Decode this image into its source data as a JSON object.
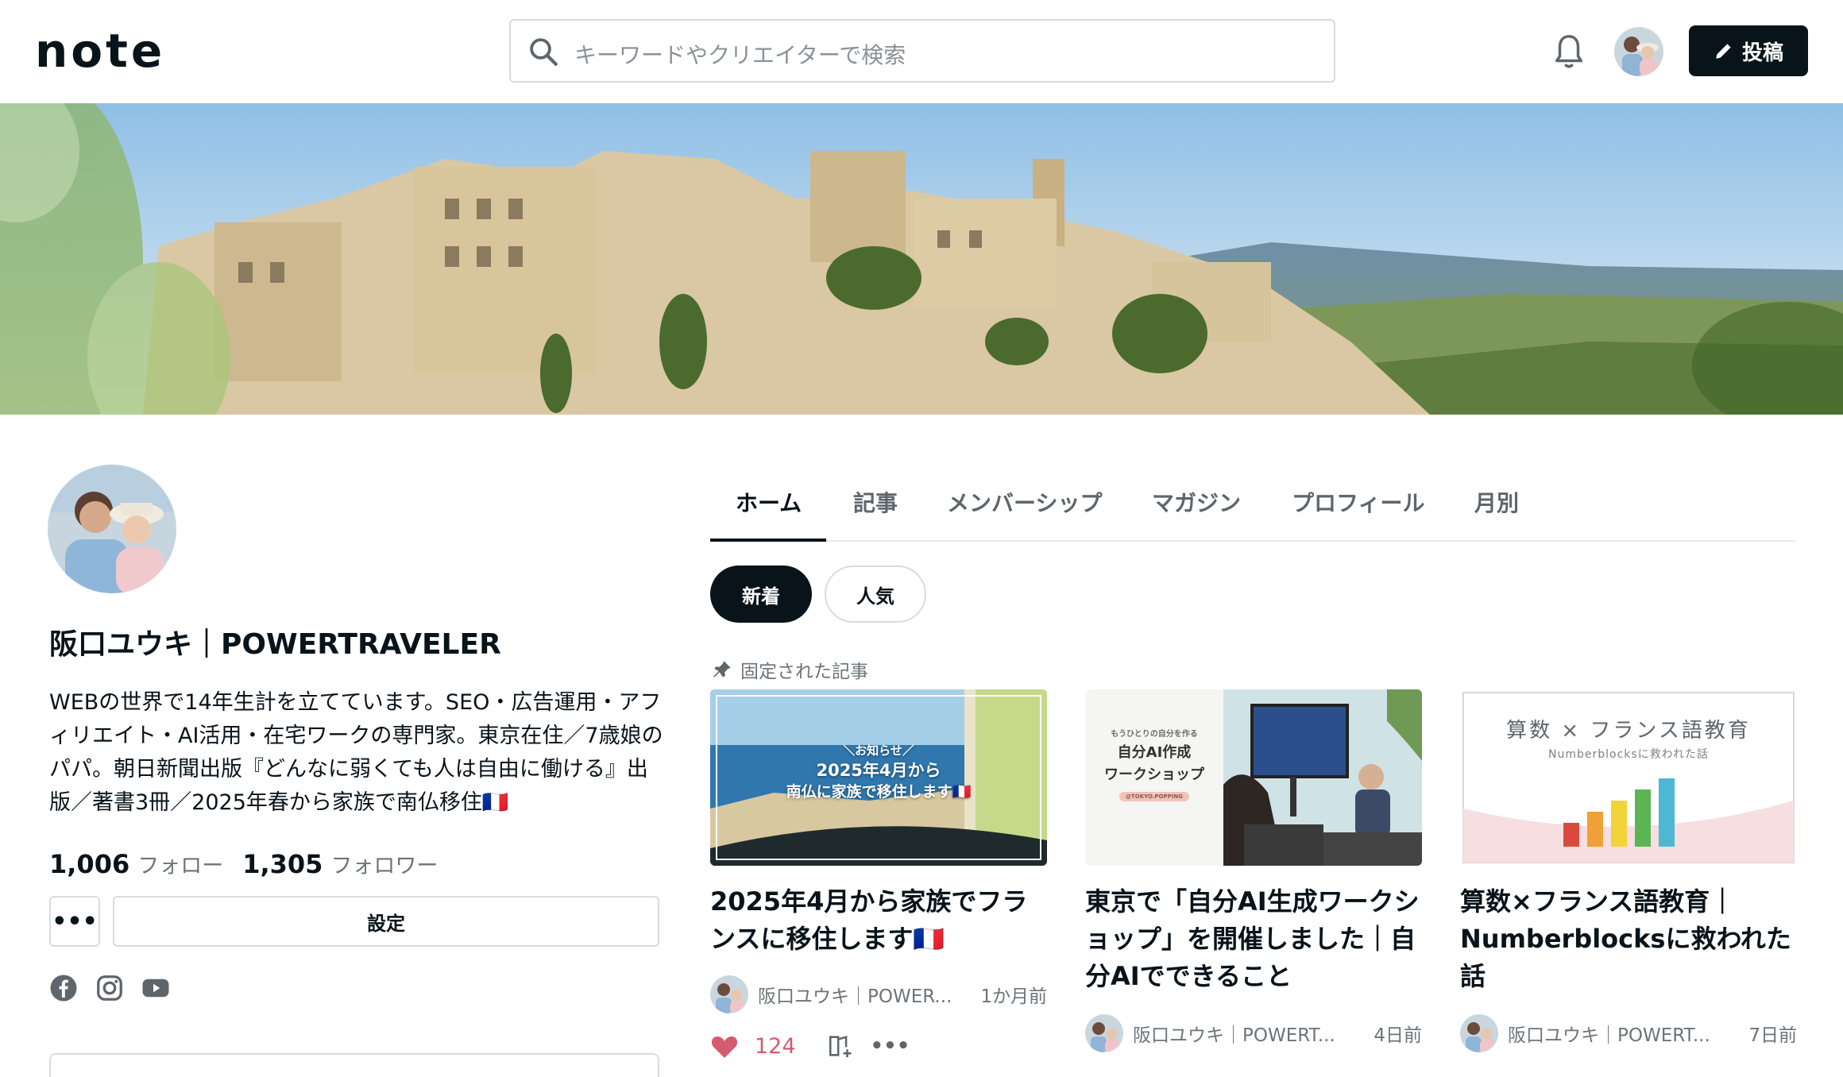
{
  "header": {
    "logo": "note",
    "search_placeholder": "キーワードやクリエイターで検索",
    "post_label": "投稿"
  },
  "profile": {
    "name": "阪口ユウキ｜POWERTRAVELER",
    "bio": "WEBの世界で14年生計を立てています。SEO・広告運用・アフィリエイト・AI活用・在宅ワークの専門家。東京在住／7歳娘のパパ。朝日新聞出版『どんなに弱くても人は自由に働ける』出版／著書3冊／2025年春から家族で南仏移住🇫🇷",
    "follow_count": "1,006",
    "follow_label": "フォロー",
    "follower_count": "1,305",
    "follower_label": "フォロワー",
    "more_label": "•••",
    "settings_label": "設定"
  },
  "tabs": [
    "ホーム",
    "記事",
    "メンバーシップ",
    "マガジン",
    "プロフィール",
    "月別"
  ],
  "filters": {
    "new": "新着",
    "popular": "人気"
  },
  "pinned_label": "固定された記事",
  "articles": [
    {
      "thumb_line1": "＼お知らせ／",
      "thumb_line2": "2025年4月から",
      "thumb_line3": "南仏に家族で移住します🇫🇷",
      "title": "2025年4月から家族でフランスに移住します🇫🇷",
      "author": "阪口ユウキ｜POWER...",
      "time": "1か月前",
      "likes": "124"
    },
    {
      "thumb_line1": "もうひとりの自分を作る",
      "thumb_line2": "自分AI作成",
      "thumb_line3": "ワークショップ",
      "thumb_tag": "@TOKYO.POPPING",
      "title": "東京で「自分AI生成ワークショップ」を開催しました｜自分AIでできること",
      "author": "阪口ユウキ｜POWERT...",
      "time": "4日前"
    },
    {
      "thumb_line1": "算数 × フランス語教育",
      "thumb_line2": "Numberblocksに救われた話",
      "title": "算数×フランス語教育｜Numberblocksに救われた話",
      "author": "阪口ユウキ｜POWERT...",
      "time": "7日前"
    }
  ],
  "icons": {
    "search": "search-icon",
    "bell": "bell-icon",
    "pen": "pen-icon",
    "pin": "pin-icon",
    "heart": "heart-icon",
    "magazine": "magazine-add-icon",
    "facebook": "facebook-icon",
    "instagram": "instagram-icon",
    "youtube": "youtube-icon"
  },
  "colors": {
    "primary": "#08131a",
    "like": "#d35c6f",
    "muted": "#6b747a",
    "border": "#d9dcde"
  }
}
